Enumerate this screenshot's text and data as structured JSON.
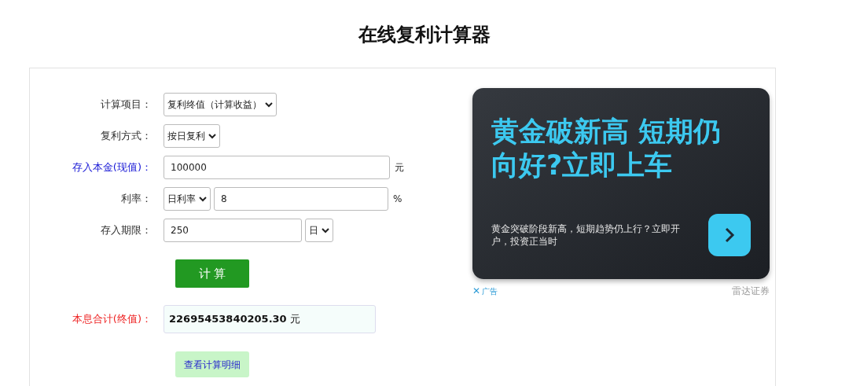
{
  "title": "在线复利计算器",
  "form": {
    "rows": [
      {
        "kind": "select",
        "label": "计算项目：",
        "select": "复利终值（计算收益）"
      },
      {
        "kind": "select",
        "label": "复利方式：",
        "select": "按日复利"
      },
      {
        "kind": "input",
        "label": "存入本金(现值)：",
        "color": "#1a1ad6",
        "value": "100000",
        "unit": "元"
      },
      {
        "kind": "select_input",
        "label": "利率：",
        "select": "日利率",
        "value": "8",
        "unit": "%"
      },
      {
        "kind": "input_select",
        "label": "存入期限：",
        "value": "250",
        "select": "日"
      }
    ],
    "calculate_button": "计 算",
    "result": {
      "label": "本息合计(终值)：",
      "color": "#ee2222",
      "value": "22695453840205.30",
      "unit": "元"
    },
    "details_button": "查看计算明细"
  },
  "ad": {
    "headline": "黄金破新高 短期仍向好?立即上车",
    "body": "黄金突破阶段新高，短期趋势仍上行？立即开户，投资正当时",
    "close": "✕",
    "tag": "广告",
    "advertiser": "雷达证券"
  }
}
